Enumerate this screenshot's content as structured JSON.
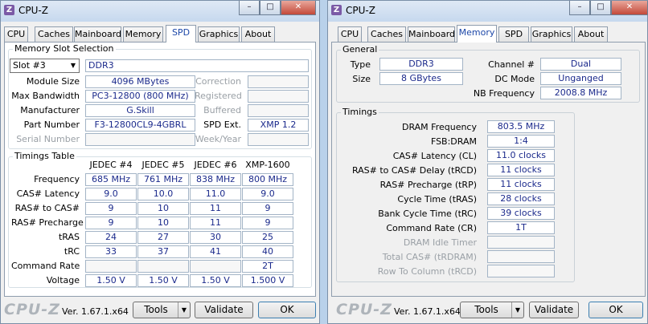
{
  "windows": [
    {
      "title": "CPU-Z",
      "tabs": [
        "CPU",
        "Caches",
        "Mainboard",
        "Memory",
        "SPD",
        "Graphics",
        "About"
      ],
      "active_tab": "SPD",
      "slot_group_label": "Memory Slot Selection",
      "slot_select": "Slot #3",
      "mem_type": "DDR3",
      "rows_left": [
        {
          "label": "Module Size",
          "value": "4096 MBytes"
        },
        {
          "label": "Max Bandwidth",
          "value": "PC3-12800 (800 MHz)"
        },
        {
          "label": "Manufacturer",
          "value": "G.Skill"
        },
        {
          "label": "Part Number",
          "value": "F3-12800CL9-4GBRL"
        },
        {
          "label": "Serial Number",
          "value": ""
        }
      ],
      "rows_right": [
        {
          "label": "Correction",
          "value": ""
        },
        {
          "label": "Registered",
          "value": ""
        },
        {
          "label": "Buffered",
          "value": ""
        },
        {
          "label": "SPD Ext.",
          "value": "XMP 1.2"
        },
        {
          "label": "Week/Year",
          "value": ""
        }
      ],
      "timings_group_label": "Timings Table",
      "timings_cols": [
        "JEDEC #4",
        "JEDEC #5",
        "JEDEC #6",
        "XMP-1600"
      ],
      "timings_rows": [
        {
          "label": "Frequency",
          "values": [
            "685 MHz",
            "761 MHz",
            "838 MHz",
            "800 MHz"
          ]
        },
        {
          "label": "CAS# Latency",
          "values": [
            "9.0",
            "10.0",
            "11.0",
            "9.0"
          ]
        },
        {
          "label": "RAS# to CAS#",
          "values": [
            "9",
            "10",
            "11",
            "9"
          ]
        },
        {
          "label": "RAS# Precharge",
          "values": [
            "9",
            "10",
            "11",
            "9"
          ]
        },
        {
          "label": "tRAS",
          "values": [
            "24",
            "27",
            "30",
            "25"
          ]
        },
        {
          "label": "tRC",
          "values": [
            "33",
            "37",
            "41",
            "40"
          ]
        },
        {
          "label": "Command Rate",
          "values": [
            "",
            "",
            "",
            "2T"
          ]
        },
        {
          "label": "Voltage",
          "values": [
            "1.50 V",
            "1.50 V",
            "1.50 V",
            "1.500 V"
          ]
        }
      ]
    },
    {
      "title": "CPU-Z",
      "tabs": [
        "CPU",
        "Caches",
        "Mainboard",
        "Memory",
        "SPD",
        "Graphics",
        "About"
      ],
      "active_tab": "Memory",
      "general_label": "General",
      "general_left": [
        {
          "label": "Type",
          "value": "DDR3"
        },
        {
          "label": "Size",
          "value": "8 GBytes"
        }
      ],
      "general_right": [
        {
          "label": "Channel #",
          "value": "Dual"
        },
        {
          "label": "DC Mode",
          "value": "Unganged"
        },
        {
          "label": "NB Frequency",
          "value": "2008.8 MHz"
        }
      ],
      "timings_label": "Timings",
      "timings": [
        {
          "label": "DRAM Frequency",
          "value": "803.5 MHz"
        },
        {
          "label": "FSB:DRAM",
          "value": "1:4"
        },
        {
          "label": "CAS# Latency (CL)",
          "value": "11.0 clocks"
        },
        {
          "label": "RAS# to CAS# Delay (tRCD)",
          "value": "11 clocks"
        },
        {
          "label": "RAS# Precharge (tRP)",
          "value": "11 clocks"
        },
        {
          "label": "Cycle Time (tRAS)",
          "value": "28 clocks"
        },
        {
          "label": "Bank Cycle Time (tRC)",
          "value": "39 clocks"
        },
        {
          "label": "Command Rate (CR)",
          "value": "1T"
        },
        {
          "label": "DRAM Idle Timer",
          "value": ""
        },
        {
          "label": "Total CAS# (tRDRAM)",
          "value": ""
        },
        {
          "label": "Row To Column (tRCD)",
          "value": ""
        }
      ]
    }
  ],
  "footer": {
    "brand": "CPU-Z",
    "version": "Ver. 1.67.1.x64",
    "tools": "Tools",
    "validate": "Validate",
    "ok": "OK"
  },
  "titlebar": {
    "minimize": "–",
    "maximize": "□",
    "close": "✕"
  },
  "icons": {
    "dropdown": "▼"
  }
}
